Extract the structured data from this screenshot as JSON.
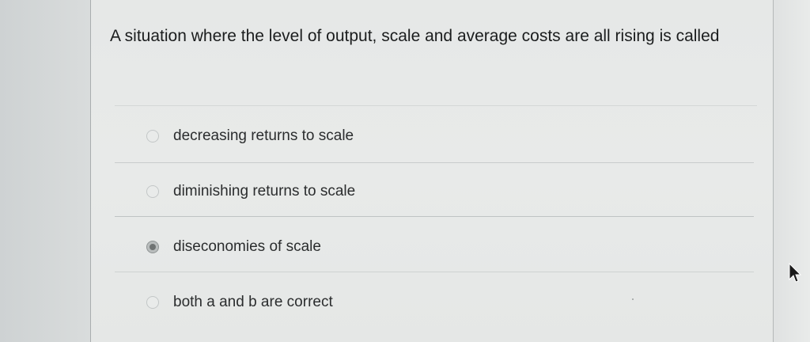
{
  "question": {
    "text": "A situation where the level of output, scale and average costs are all rising is called"
  },
  "options": [
    {
      "label": "decreasing returns to scale",
      "selected": false
    },
    {
      "label": "diminishing returns to scale",
      "selected": false
    },
    {
      "label": "diseconomies of scale",
      "selected": true
    },
    {
      "label": "both a and b are correct",
      "selected": false
    }
  ],
  "icons": {
    "cursor": "mouse-pointer-icon",
    "radio_selected": "radio-selected-icon",
    "radio_unselected": "radio-unselected-icon"
  },
  "colors": {
    "panel_background": "#e7e9e8",
    "page_background": "#d6d9d9",
    "text": "#1b1d1e"
  }
}
